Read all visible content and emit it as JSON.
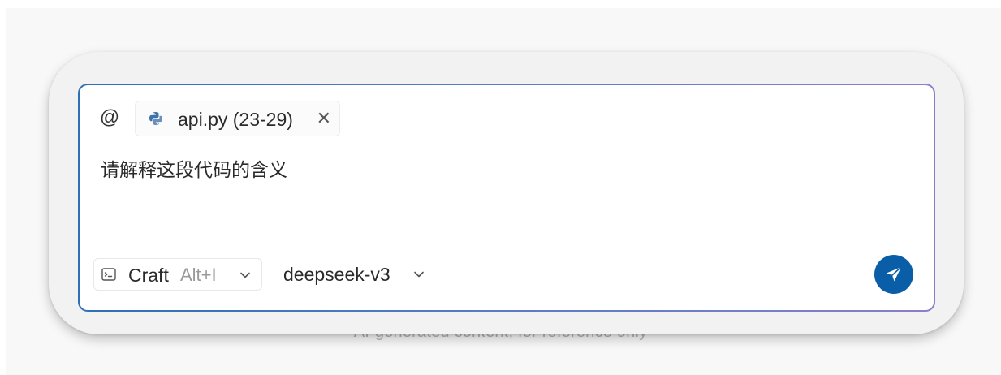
{
  "footer": {
    "disclaimer": "AI-generated content, for reference only"
  },
  "composer": {
    "mention_symbol": "@",
    "attachment": {
      "icon": "python-icon",
      "label": "api.py (23-29)",
      "close_symbol": "✕"
    },
    "prompt_text": "请解释这段代码的含义",
    "mode": {
      "icon": "terminal-window-icon",
      "label": "Craft",
      "shortcut": "Alt+I"
    },
    "model": {
      "label": "deepseek-v3"
    },
    "send": {
      "icon": "send-icon"
    }
  },
  "colors": {
    "accent": "#0a5ea8",
    "border_gradient_start": "#2f6fb5",
    "border_gradient_end": "#8b7fc9"
  }
}
